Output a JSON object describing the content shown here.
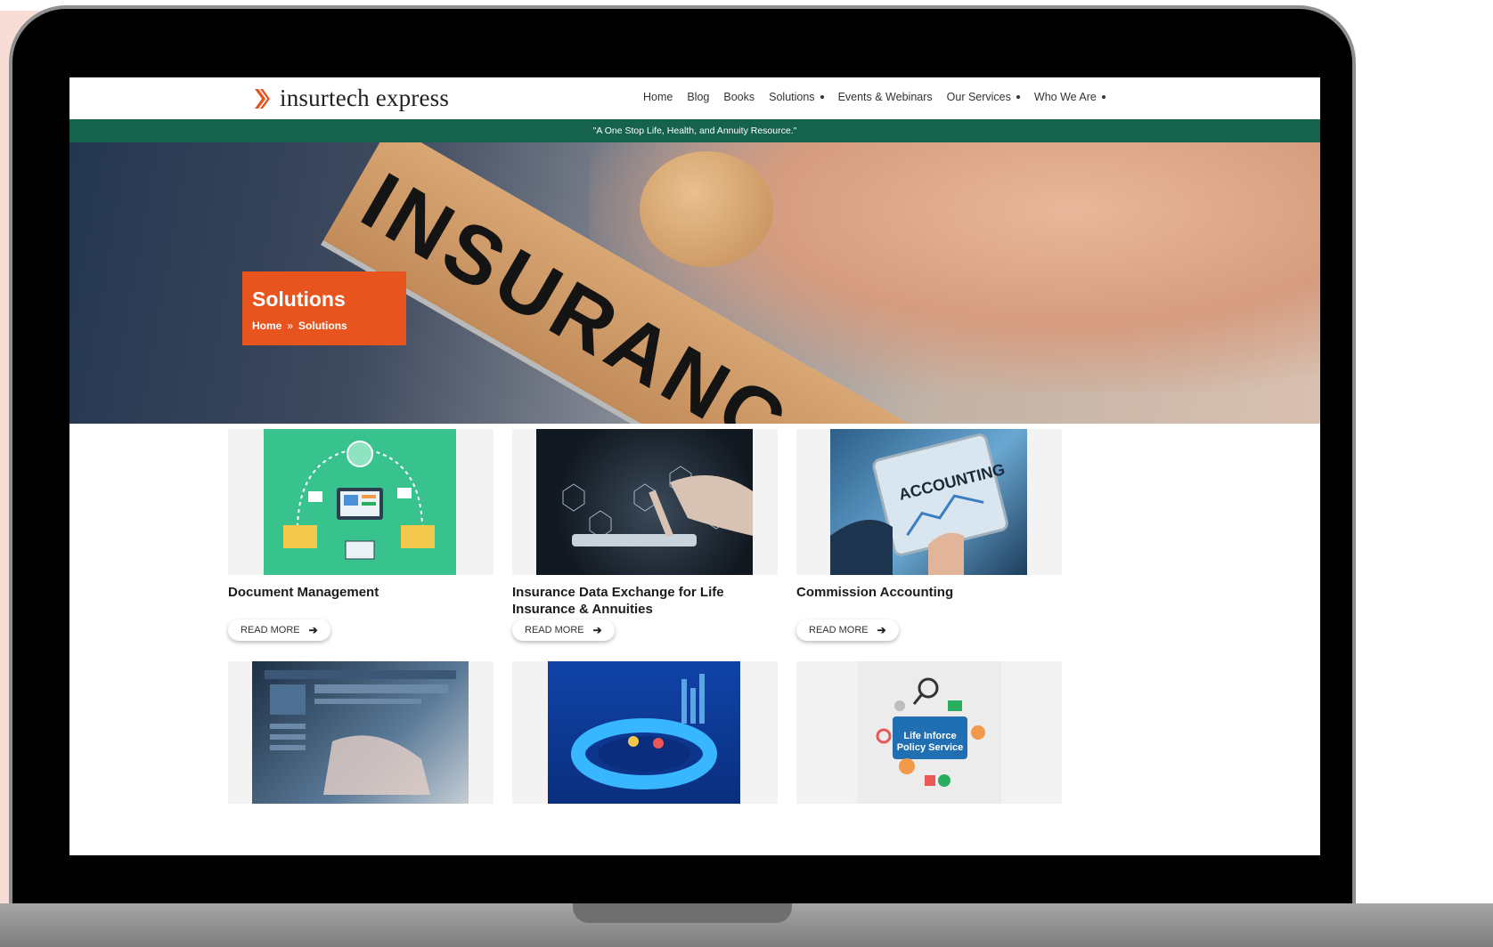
{
  "site": {
    "logo_text": "insurtech express",
    "nav": [
      {
        "label": "Home",
        "dropdown": false
      },
      {
        "label": "Blog",
        "dropdown": false
      },
      {
        "label": "Books",
        "dropdown": false
      },
      {
        "label": "Solutions",
        "dropdown": true
      },
      {
        "label": "Events & Webinars",
        "dropdown": false
      },
      {
        "label": "Our Services",
        "dropdown": true
      },
      {
        "label": "Who We Are",
        "dropdown": true
      }
    ],
    "tagline": "\"A One Stop Life, Health, and Annuity Resource.\""
  },
  "hero": {
    "stamp_text": "INSURANC",
    "title": "Solutions",
    "breadcrumb": {
      "home": "Home",
      "separator": "»",
      "current": "Solutions"
    }
  },
  "cards": [
    {
      "title": "Document Management",
      "read_more": "READ MORE",
      "image_icon": "document-management-illustration"
    },
    {
      "title": "Insurance Data Exchange for Life Insurance & Annuities",
      "read_more": "READ MORE",
      "image_icon": "data-exchange-photo"
    },
    {
      "title": "Commission Accounting",
      "read_more": "READ MORE",
      "image_icon": "accounting-tablet-photo"
    },
    {
      "title": "",
      "read_more": "",
      "image_icon": "laptop-dashboard-photo"
    },
    {
      "title": "",
      "read_more": "",
      "image_icon": "data-ring-illustration"
    },
    {
      "title": "",
      "read_more": "",
      "image_icon": "life-inforce-policy-service-illustration",
      "image_text": "Life Inforce Policy Service"
    }
  ],
  "colors": {
    "brand_green": "#15634c",
    "accent_orange": "#e8541e",
    "text_dark": "#1c1c1c"
  }
}
